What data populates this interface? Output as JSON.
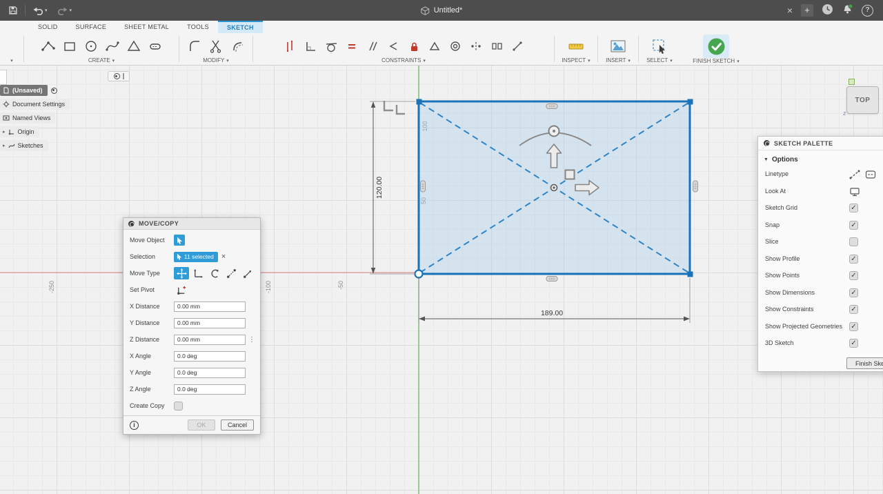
{
  "icons": {
    "caret_down": "▾",
    "close": "×",
    "add_tab": "+",
    "help": "?",
    "check": "✓",
    "overflow_dots": "⋮",
    "expander": "▸",
    "section_arrow": "▼",
    "info": "i"
  },
  "titlebar": {
    "title": "Untitled*"
  },
  "ribbon": {
    "tabs": [
      {
        "label": "SOLID",
        "active": false
      },
      {
        "label": "SURFACE",
        "active": false
      },
      {
        "label": "SHEET METAL",
        "active": false
      },
      {
        "label": "TOOLS",
        "active": false
      },
      {
        "label": "SKETCH",
        "active": true
      }
    ],
    "groups": [
      {
        "label": "CREATE"
      },
      {
        "label": "MODIFY"
      },
      {
        "label": "CONSTRAINTS"
      },
      {
        "label": "INSPECT"
      },
      {
        "label": "INSERT"
      },
      {
        "label": "SELECT"
      },
      {
        "label": "FINISH SKETCH"
      }
    ]
  },
  "browser": {
    "items": [
      {
        "label": "(Unsaved)"
      },
      {
        "label": "Document Settings"
      },
      {
        "label": "Named Views"
      },
      {
        "label": "Origin"
      },
      {
        "label": "Sketches"
      }
    ]
  },
  "canvas": {
    "dim_width": "189.00",
    "dim_height": "120.00",
    "x_axis_labels": [
      "-250",
      "-100",
      "-50"
    ],
    "y_axis_labels": [
      "100",
      "50"
    ],
    "viewcube_face": "TOP",
    "viewcube_axis": "z"
  },
  "move_dialog": {
    "title": "MOVE/COPY",
    "labels": {
      "move_object": "Move Object",
      "selection": "Selection",
      "move_type": "Move Type",
      "set_pivot": "Set Pivot",
      "x_distance": "X Distance",
      "y_distance": "Y Distance",
      "z_distance": "Z Distance",
      "x_angle": "X Angle",
      "y_angle": "Y Angle",
      "z_angle": "Z Angle",
      "create_copy": "Create Copy"
    },
    "values": {
      "selection": "11 selected",
      "x_distance": "0.00 mm",
      "y_distance": "0.00 mm",
      "z_distance": "0.00 mm",
      "x_angle": "0.0 deg",
      "y_angle": "0.0 deg",
      "z_angle": "0.0 deg"
    },
    "buttons": {
      "ok": "OK",
      "cancel": "Cancel"
    }
  },
  "sketch_palette": {
    "title": "SKETCH PALETTE",
    "section": "Options",
    "rows": [
      {
        "label": "Linetype",
        "checked": false
      },
      {
        "label": "Look At",
        "checked": false
      },
      {
        "label": "Sketch Grid",
        "checked": true
      },
      {
        "label": "Snap",
        "checked": true
      },
      {
        "label": "Slice",
        "checked": false
      },
      {
        "label": "Show Profile",
        "checked": true
      },
      {
        "label": "Show Points",
        "checked": true
      },
      {
        "label": "Show Dimensions",
        "checked": true
      },
      {
        "label": "Show Constraints",
        "checked": true
      },
      {
        "label": "Show Projected Geometries",
        "checked": true
      },
      {
        "label": "3D Sketch",
        "checked": true
      }
    ],
    "finish_button": "Finish Sketch"
  }
}
